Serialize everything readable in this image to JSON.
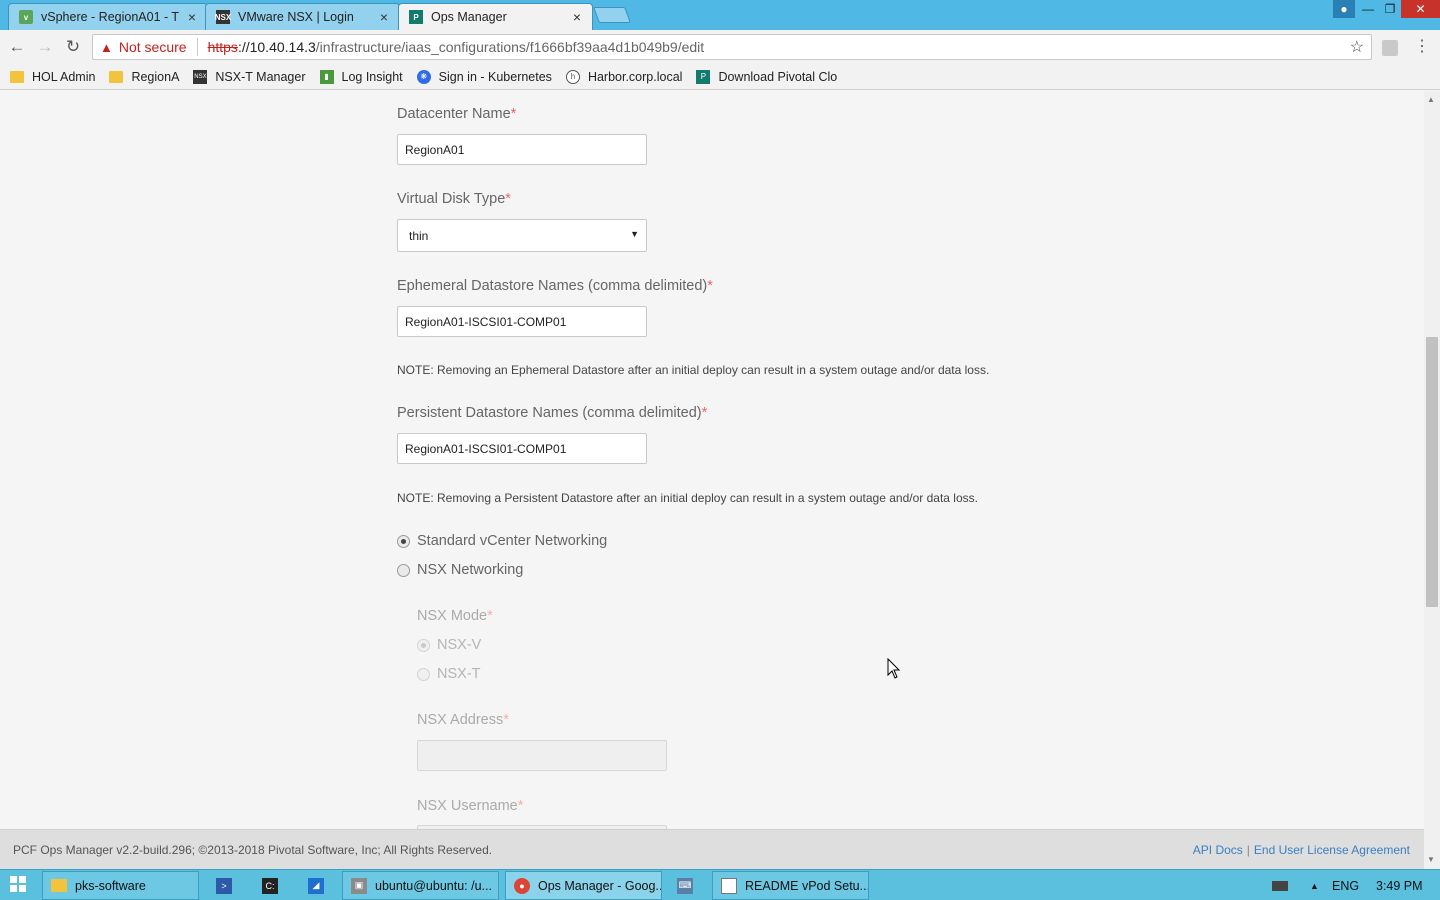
{
  "browser": {
    "tabs": [
      {
        "title": "vSphere - RegionA01 - T",
        "icon": "vsphere-icon",
        "active": false
      },
      {
        "title": "VMware NSX | Login",
        "icon": "nsx-icon",
        "active": false
      },
      {
        "title": "Ops Manager",
        "icon": "pivotal-icon",
        "active": true
      }
    ],
    "address": {
      "security_label": "Not secure",
      "scheme": "https",
      "host": "://10.40.14.3",
      "path": "/infrastructure/iaas_configurations/f1666bf39aa4d1b049b9/edit"
    },
    "bookmarks": [
      {
        "label": "HOL Admin",
        "icon": "folder-icon"
      },
      {
        "label": "RegionA",
        "icon": "folder-icon"
      },
      {
        "label": "NSX-T Manager",
        "icon": "nsx-icon"
      },
      {
        "label": "Log Insight",
        "icon": "chart-icon"
      },
      {
        "label": "Sign in - Kubernetes",
        "icon": "kubernetes-icon"
      },
      {
        "label": "Harbor.corp.local",
        "icon": "harbor-icon"
      },
      {
        "label": "Download Pivotal Clo",
        "icon": "pivotal-icon"
      }
    ]
  },
  "form": {
    "datacenter": {
      "label": "Datacenter Name",
      "required": "*",
      "value": "RegionA01"
    },
    "disk_type": {
      "label": "Virtual Disk Type",
      "required": "*",
      "value": "thin"
    },
    "ephemeral": {
      "label": "Ephemeral Datastore Names (comma delimited)",
      "required": "*",
      "value": "RegionA01-ISCSI01-COMP01",
      "note": "NOTE: Removing an Ephemeral Datastore after an initial deploy can result in a system outage and/or data loss."
    },
    "persistent": {
      "label": "Persistent Datastore Names (comma delimited)",
      "required": "*",
      "value": "RegionA01-ISCSI01-COMP01",
      "note": "NOTE: Removing a Persistent Datastore after an initial deploy can result in a system outage and/or data loss."
    },
    "networking": {
      "standard": {
        "label": "Standard vCenter Networking",
        "selected": true
      },
      "nsx": {
        "label": "NSX Networking",
        "selected": false
      }
    },
    "nsx_mode": {
      "label": "NSX Mode",
      "required": "*",
      "options": [
        {
          "label": "NSX-V",
          "selected": true
        },
        {
          "label": "NSX-T",
          "selected": false
        }
      ]
    },
    "nsx_address": {
      "label": "NSX Address",
      "required": "*",
      "value": ""
    },
    "nsx_username": {
      "label": "NSX Username",
      "required": "*"
    }
  },
  "footer": {
    "copyright": "PCF Ops Manager v2.2-build.296; ©2013-2018 Pivotal Software, Inc; All Rights Reserved.",
    "api_docs": "API Docs",
    "separator": "|",
    "eula": "End User License Agreement"
  },
  "taskbar": {
    "items": [
      {
        "label": "pks-software",
        "icon": "folder-icon"
      },
      {
        "label": "ubuntu@ubuntu: /u...",
        "icon": "putty-icon"
      },
      {
        "label": "Ops Manager - Goog...",
        "icon": "chrome-icon"
      },
      {
        "label": "README  vPod Setu...",
        "icon": "notepad-icon"
      }
    ],
    "language": "ENG",
    "time": "3:49 PM"
  },
  "colors": {
    "accent": "#4fb8e4",
    "warning": "#c5221f",
    "required": "#e66666",
    "link": "#3a7fc2"
  }
}
